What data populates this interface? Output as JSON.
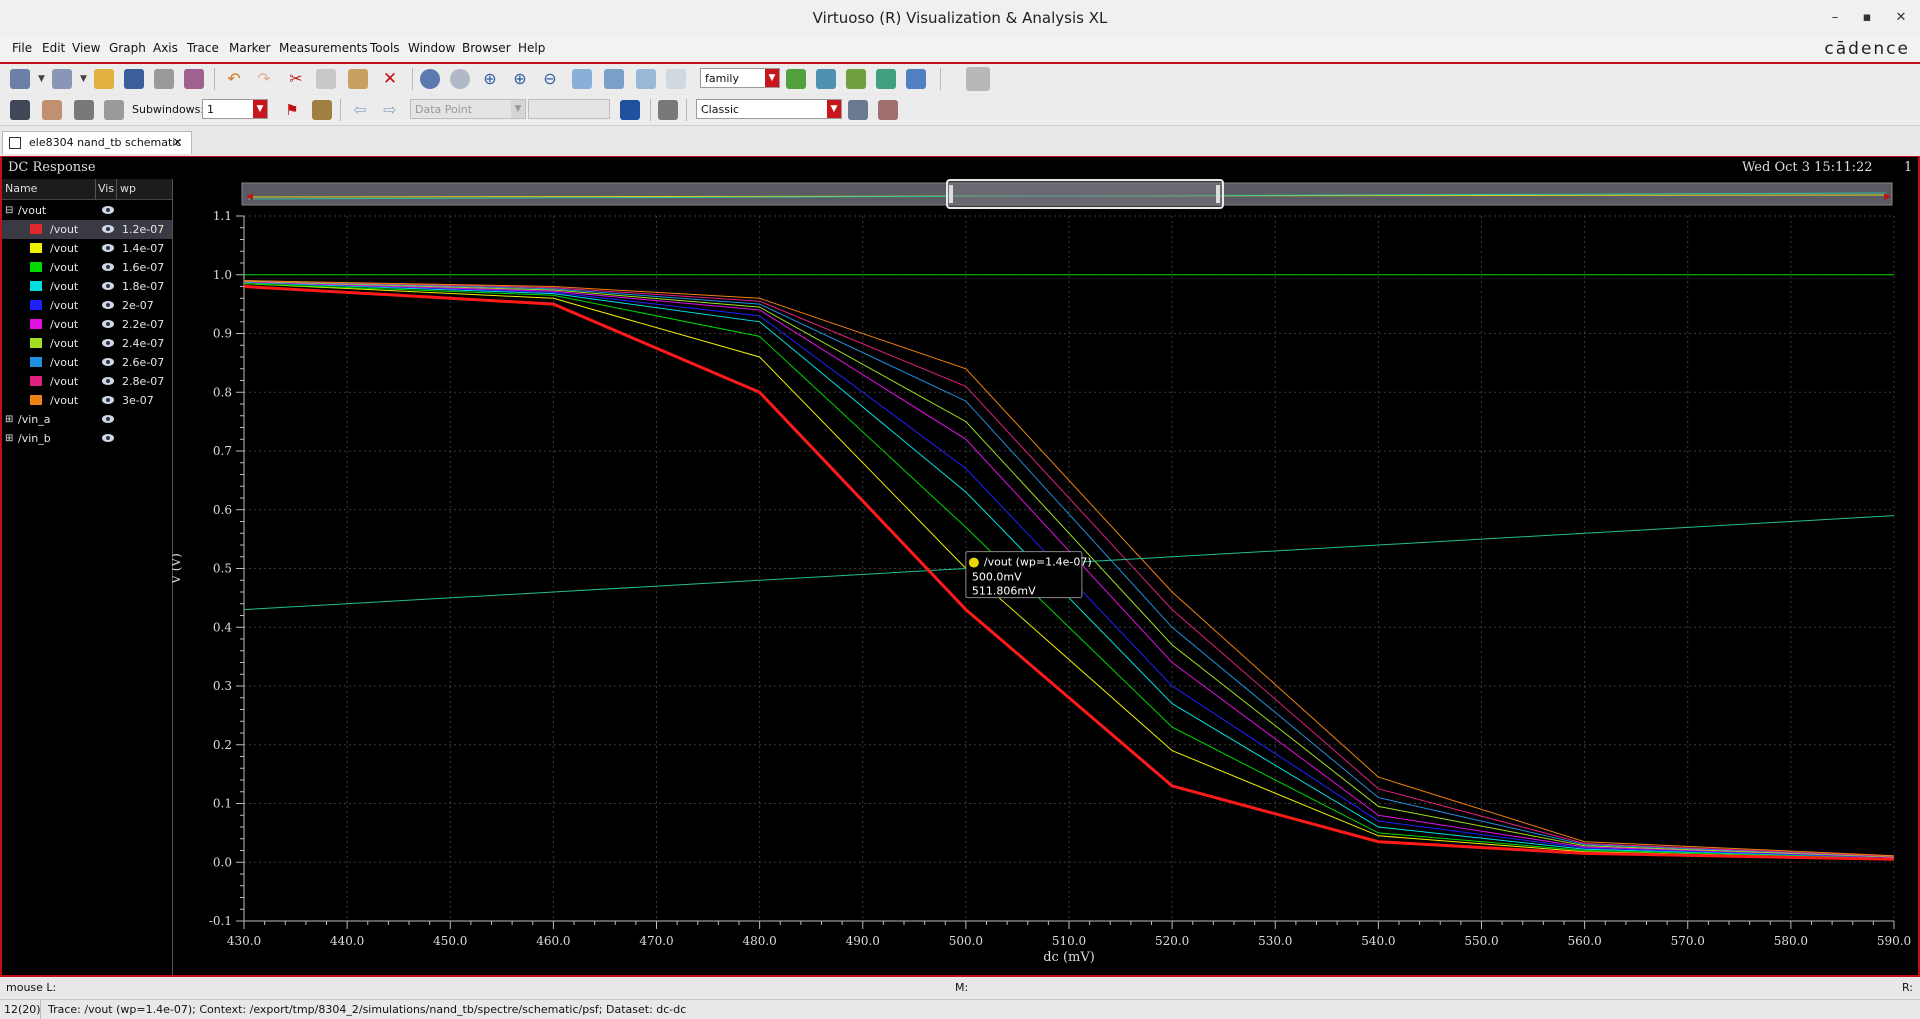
{
  "window": {
    "title": "Virtuoso (R) Visualization & Analysis XL",
    "minimize": "–",
    "maximize": "▪",
    "close": "✕"
  },
  "menubar": {
    "items": [
      "File",
      "Edit",
      "View",
      "Graph",
      "Axis",
      "Trace",
      "Marker",
      "Measurements",
      "Tools",
      "Window",
      "Browser",
      "Help"
    ],
    "logo": "cādence"
  },
  "toolbar1": {
    "family_select": "family"
  },
  "toolbar2": {
    "subwindows_label": "Subwindows:",
    "subwindows_value": "1",
    "datapoint_select": "Data Point",
    "datapoint_value": "",
    "style_select": "Classic"
  },
  "tab": {
    "label": "ele8304 nand_tb schematic",
    "close": "✕"
  },
  "pane": {
    "title": "DC Response",
    "timestamp": "Wed Oct 3 15:11:22",
    "subwindow_number": "1"
  },
  "legend": {
    "headers": {
      "name": "Name",
      "vis": "Vis",
      "param": "wp"
    },
    "groups": [
      {
        "name": "/vout",
        "expander": "⊟",
        "traces": [
          {
            "name": "/vout",
            "wp": "1.2e-07",
            "color": "#e0282d"
          },
          {
            "name": "/vout",
            "wp": "1.4e-07",
            "color": "#f0f000"
          },
          {
            "name": "/vout",
            "wp": "1.6e-07",
            "color": "#00d800"
          },
          {
            "name": "/vout",
            "wp": "1.8e-07",
            "color": "#00e0e0"
          },
          {
            "name": "/vout",
            "wp": "2e-07",
            "color": "#2020ff"
          },
          {
            "name": "/vout",
            "wp": "2.2e-07",
            "color": "#e010e0"
          },
          {
            "name": "/vout",
            "wp": "2.4e-07",
            "color": "#a0e020"
          },
          {
            "name": "/vout",
            "wp": "2.6e-07",
            "color": "#2090e0"
          },
          {
            "name": "/vout",
            "wp": "2.8e-07",
            "color": "#e02080"
          },
          {
            "name": "/vout",
            "wp": "3e-07",
            "color": "#f08010"
          }
        ]
      },
      {
        "name": "/vin_a",
        "expander": "⊞",
        "traces": []
      },
      {
        "name": "/vin_b",
        "expander": "⊞",
        "traces": []
      }
    ]
  },
  "marker": {
    "label": "/vout (wp=1.4e-07)",
    "x_text": "500.0mV",
    "y_text": "511.806mV",
    "x": 500,
    "y": 0.5118
  },
  "status": {
    "mouse_l": "mouse L:",
    "mouse_m": "M:",
    "mouse_r": "R:",
    "counter": "12(20)",
    "message": "Trace: /vout (wp=1.4e-07); Context: /export/tmp/8304_2/simulations/nand_tb/spectre/schematic/psf; Dataset: dc-dc"
  },
  "chart_data": {
    "type": "line",
    "xlabel": "dc (mV)",
    "ylabel": "V (V)",
    "xlim": [
      430,
      590
    ],
    "ylim": [
      -0.1,
      1.1
    ],
    "xticks": [
      430,
      440,
      450,
      460,
      470,
      480,
      490,
      500,
      510,
      520,
      530,
      540,
      550,
      560,
      570,
      580,
      590
    ],
    "xtick_labels": [
      "430.0",
      "440.0",
      "450.0",
      "460.0",
      "470.0",
      "480.0",
      "490.0",
      "500.0",
      "510.0",
      "520.0",
      "530.0",
      "540.0",
      "550.0",
      "560.0",
      "570.0",
      "580.0",
      "590.0"
    ],
    "yticks": [
      -0.1,
      0,
      0.1,
      0.2,
      0.3,
      0.4,
      0.5,
      0.6,
      0.7,
      0.8,
      0.9,
      1.0,
      1.1
    ],
    "ytick_labels": [
      "-0.1",
      "0.0",
      "0.1",
      "0.2",
      "0.3",
      "0.4",
      "0.5",
      "0.6",
      "0.7",
      "0.8",
      "0.9",
      "1.0",
      "1.1"
    ],
    "grid": true,
    "x": [
      430,
      460,
      480,
      500,
      520,
      540,
      560,
      590
    ],
    "series": [
      {
        "name": "/vout wp=1.2e-07",
        "color": "#ff1a1a",
        "width": 3,
        "values": [
          0.98,
          0.95,
          0.8,
          0.43,
          0.13,
          0.035,
          0.015,
          0.005
        ]
      },
      {
        "name": "/vout wp=1.4e-07",
        "color": "#f0f000",
        "width": 1,
        "values": [
          0.985,
          0.96,
          0.86,
          0.5,
          0.19,
          0.045,
          0.018,
          0.006
        ]
      },
      {
        "name": "/vout wp=1.6e-07",
        "color": "#00d800",
        "width": 1,
        "values": [
          0.985,
          0.965,
          0.895,
          0.57,
          0.23,
          0.05,
          0.02,
          0.007
        ]
      },
      {
        "name": "/vout wp=1.8e-07",
        "color": "#00e0e0",
        "width": 1,
        "values": [
          0.987,
          0.968,
          0.92,
          0.63,
          0.27,
          0.06,
          0.022,
          0.008
        ]
      },
      {
        "name": "/vout wp=2e-07",
        "color": "#2020ff",
        "width": 1,
        "values": [
          0.988,
          0.97,
          0.93,
          0.67,
          0.3,
          0.07,
          0.024,
          0.008
        ]
      },
      {
        "name": "/vout wp=2.2e-07",
        "color": "#e010e0",
        "width": 1,
        "values": [
          0.988,
          0.972,
          0.94,
          0.72,
          0.34,
          0.08,
          0.026,
          0.009
        ]
      },
      {
        "name": "/vout wp=2.4e-07",
        "color": "#a0e020",
        "width": 1,
        "values": [
          0.989,
          0.974,
          0.945,
          0.75,
          0.37,
          0.095,
          0.028,
          0.009
        ]
      },
      {
        "name": "/vout wp=2.6e-07",
        "color": "#2090e0",
        "width": 1,
        "values": [
          0.99,
          0.976,
          0.95,
          0.785,
          0.4,
          0.11,
          0.03,
          0.01
        ]
      },
      {
        "name": "/vout wp=2.8e-07",
        "color": "#e02080",
        "width": 1,
        "values": [
          0.99,
          0.978,
          0.955,
          0.81,
          0.43,
          0.125,
          0.032,
          0.01
        ]
      },
      {
        "name": "/vout wp=3e-07",
        "color": "#f08010",
        "width": 1,
        "values": [
          0.99,
          0.98,
          0.96,
          0.84,
          0.46,
          0.145,
          0.035,
          0.011
        ]
      },
      {
        "name": "/vin_a",
        "color": "#00d000",
        "width": 1,
        "values": [
          1.0,
          1.0,
          1.0,
          1.0,
          1.0,
          1.0,
          1.0,
          1.0
        ]
      },
      {
        "name": "/vin_b",
        "color": "#20c090",
        "width": 1,
        "values": [
          0.43,
          0.46,
          0.48,
          0.5,
          0.52,
          0.54,
          0.56,
          0.59
        ]
      }
    ]
  }
}
